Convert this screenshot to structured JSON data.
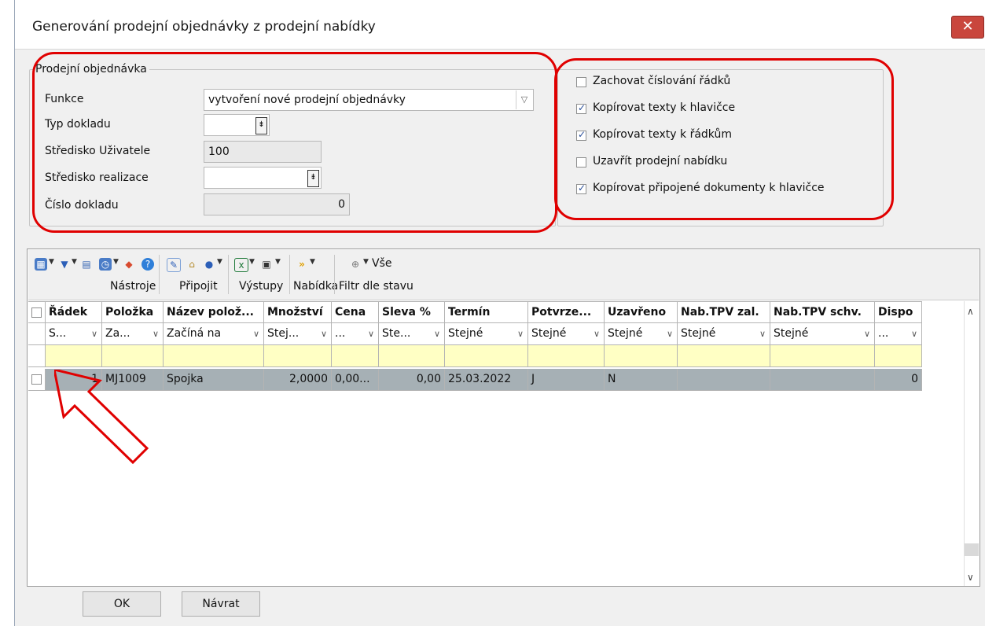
{
  "window": {
    "title": "Generování prodejní objednávky z prodejní nabídky",
    "close_glyph": "✕"
  },
  "order_group": {
    "legend": "Prodejní objednávka",
    "funkce": {
      "label": "Funkce",
      "value": "vytvoření nové prodejní objednávky"
    },
    "typ_dokladu": {
      "label": "Typ dokladu",
      "value": ""
    },
    "stredisko_uzivatele": {
      "label": "Středisko Uživatele",
      "value": "100"
    },
    "stredisko_realizace": {
      "label": "Středisko realizace",
      "value": ""
    },
    "cislo_dokladu": {
      "label": "Číslo dokladu",
      "value": "0"
    }
  },
  "options": [
    {
      "label": "Zachovat číslování řádků",
      "checked": false
    },
    {
      "label": "Kopírovat texty k hlavičce",
      "checked": true
    },
    {
      "label": "Kopírovat texty k řádkům",
      "checked": true
    },
    {
      "label": "Uzavřít prodejní nabídku",
      "checked": false
    },
    {
      "label": "Kopírovat připojené dokumenty k hlavičce",
      "checked": true
    }
  ],
  "toolbar": {
    "groups": [
      "Nástroje",
      "Připojit",
      "Výstupy",
      "Nabídka",
      "Filtr dle stavu"
    ],
    "vse_label": "Vše"
  },
  "grid": {
    "columns": [
      "Řádek",
      "Položka",
      "Název polož...",
      "Množství",
      "Cena",
      "Sleva %",
      "Termín",
      "Potvrze...",
      "Uzavřeno",
      "Nab.TPV zal.",
      "Nab.TPV schv.",
      "Dispo"
    ],
    "filters": [
      "S...",
      "Za...",
      "Začíná na",
      "Stej...",
      "...",
      "Ste...",
      "Stejné",
      "Stejné",
      "Stejné",
      "Stejné",
      "Stejné",
      "..."
    ],
    "rows": [
      {
        "cells": [
          "1",
          "MJ1009",
          "Spojka",
          "2,0000",
          "0,00...",
          "0,00",
          "25.03.2022",
          "J",
          "N",
          "",
          "",
          "0"
        ]
      }
    ]
  },
  "buttons": {
    "ok": "OK",
    "back": "Návrat"
  },
  "colors": {
    "highlight": "#e00000",
    "filter_row": "#ffffc4",
    "selected_row": "#a6b0b5"
  }
}
